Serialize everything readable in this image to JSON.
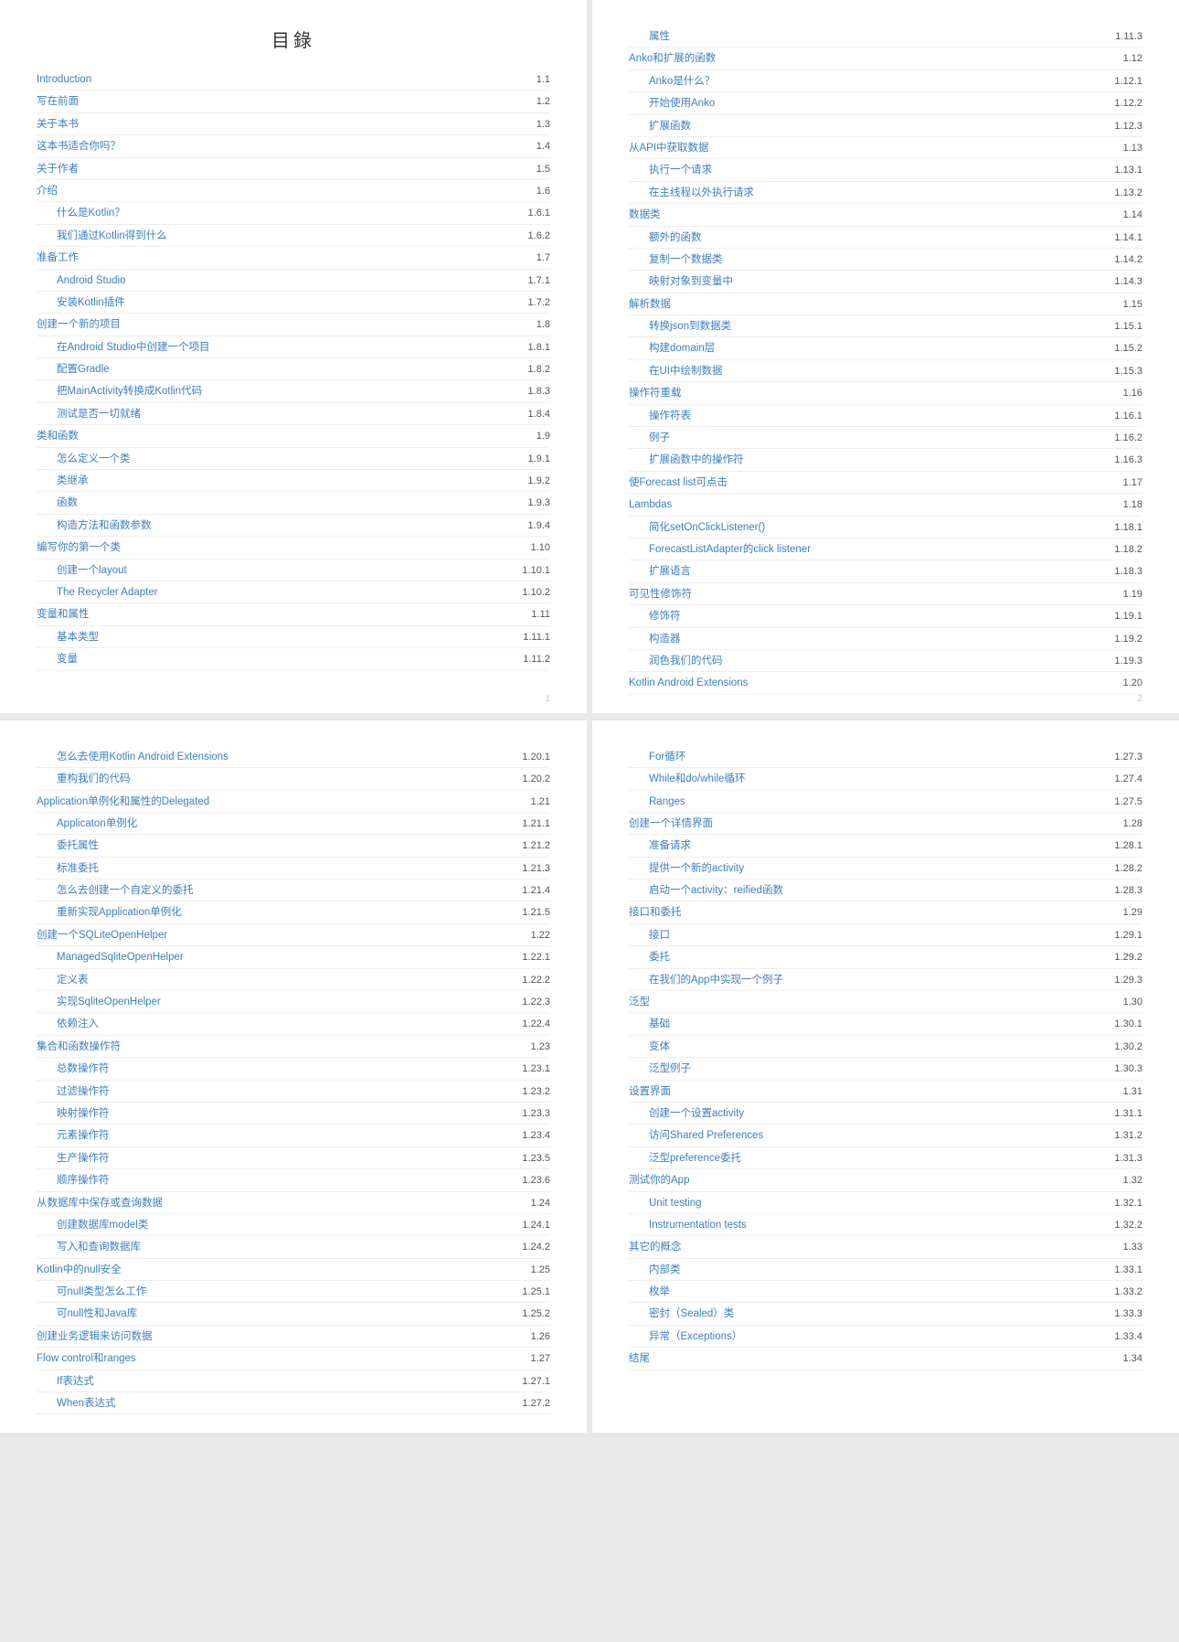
{
  "title": "目錄",
  "pages": [
    {
      "pageNumber": "1",
      "showTitle": true,
      "entries": [
        {
          "label": "Introduction",
          "num": "1.1",
          "level": 0
        },
        {
          "label": "写在前面",
          "num": "1.2",
          "level": 0
        },
        {
          "label": "关于本书",
          "num": "1.3",
          "level": 0
        },
        {
          "label": "这本书适合你吗？",
          "num": "1.4",
          "level": 0
        },
        {
          "label": "关于作者",
          "num": "1.5",
          "level": 0
        },
        {
          "label": "介绍",
          "num": "1.6",
          "level": 0
        },
        {
          "label": "什么是Kotlin？",
          "num": "1.6.1",
          "level": 1
        },
        {
          "label": "我们通过Kotlin得到什么",
          "num": "1.6.2",
          "level": 1
        },
        {
          "label": "准备工作",
          "num": "1.7",
          "level": 0
        },
        {
          "label": "Android Studio",
          "num": "1.7.1",
          "level": 1
        },
        {
          "label": "安装Kotlin插件",
          "num": "1.7.2",
          "level": 1
        },
        {
          "label": "创建一个新的项目",
          "num": "1.8",
          "level": 0
        },
        {
          "label": "在Android Studio中创建一个项目",
          "num": "1.8.1",
          "level": 1
        },
        {
          "label": "配置Gradle",
          "num": "1.8.2",
          "level": 1
        },
        {
          "label": "把MainActivity转换成Kotlin代码",
          "num": "1.8.3",
          "level": 1
        },
        {
          "label": "测试是否一切就绪",
          "num": "1.8.4",
          "level": 1
        },
        {
          "label": "类和函数",
          "num": "1.9",
          "level": 0
        },
        {
          "label": "怎么定义一个类",
          "num": "1.9.1",
          "level": 1
        },
        {
          "label": "类继承",
          "num": "1.9.2",
          "level": 1
        },
        {
          "label": "函数",
          "num": "1.9.3",
          "level": 1
        },
        {
          "label": "构造方法和函数参数",
          "num": "1.9.4",
          "level": 1
        },
        {
          "label": "编写你的第一个类",
          "num": "1.10",
          "level": 0
        },
        {
          "label": "创建一个layout",
          "num": "1.10.1",
          "level": 1
        },
        {
          "label": "The Recycler Adapter",
          "num": "1.10.2",
          "level": 1
        },
        {
          "label": "变量和属性",
          "num": "1.11",
          "level": 0
        },
        {
          "label": "基本类型",
          "num": "1.11.1",
          "level": 1
        },
        {
          "label": "变量",
          "num": "1.11.2",
          "level": 1
        }
      ]
    },
    {
      "pageNumber": "2",
      "showTitle": false,
      "entries": [
        {
          "label": "属性",
          "num": "1.11.3",
          "level": 1
        },
        {
          "label": "Anko和扩展的函数",
          "num": "1.12",
          "level": 0
        },
        {
          "label": "Anko是什么？",
          "num": "1.12.1",
          "level": 1
        },
        {
          "label": "开始使用Anko",
          "num": "1.12.2",
          "level": 1
        },
        {
          "label": "扩展函数",
          "num": "1.12.3",
          "level": 1
        },
        {
          "label": "从API中获取数据",
          "num": "1.13",
          "level": 0
        },
        {
          "label": "执行一个请求",
          "num": "1.13.1",
          "level": 1
        },
        {
          "label": "在主线程以外执行请求",
          "num": "1.13.2",
          "level": 1
        },
        {
          "label": "数据类",
          "num": "1.14",
          "level": 0
        },
        {
          "label": "额外的函数",
          "num": "1.14.1",
          "level": 1
        },
        {
          "label": "复制一个数据类",
          "num": "1.14.2",
          "level": 1
        },
        {
          "label": "映射对象到变量中",
          "num": "1.14.3",
          "level": 1
        },
        {
          "label": "解析数据",
          "num": "1.15",
          "level": 0
        },
        {
          "label": "转换json到数据类",
          "num": "1.15.1",
          "level": 1
        },
        {
          "label": "构建domain层",
          "num": "1.15.2",
          "level": 1
        },
        {
          "label": "在UI中绘制数据",
          "num": "1.15.3",
          "level": 1
        },
        {
          "label": "操作符重载",
          "num": "1.16",
          "level": 0
        },
        {
          "label": "操作符表",
          "num": "1.16.1",
          "level": 1
        },
        {
          "label": "例子",
          "num": "1.16.2",
          "level": 1
        },
        {
          "label": "扩展函数中的操作符",
          "num": "1.16.3",
          "level": 1
        },
        {
          "label": "使Forecast list可点击",
          "num": "1.17",
          "level": 0
        },
        {
          "label": "Lambdas",
          "num": "1.18",
          "level": 0
        },
        {
          "label": "简化setOnClickListener()",
          "num": "1.18.1",
          "level": 1
        },
        {
          "label": "ForecastListAdapter的click listener",
          "num": "1.18.2",
          "level": 1
        },
        {
          "label": "扩展语言",
          "num": "1.18.3",
          "level": 1
        },
        {
          "label": "可见性修饰符",
          "num": "1.19",
          "level": 0
        },
        {
          "label": "修饰符",
          "num": "1.19.1",
          "level": 1
        },
        {
          "label": "构造器",
          "num": "1.19.2",
          "level": 1
        },
        {
          "label": "润色我们的代码",
          "num": "1.19.3",
          "level": 1
        },
        {
          "label": "Kotlin Android Extensions",
          "num": "1.20",
          "level": 0
        }
      ]
    },
    {
      "pageNumber": "",
      "showTitle": false,
      "entries": [
        {
          "label": "怎么去使用Kotlin Android Extensions",
          "num": "1.20.1",
          "level": 1
        },
        {
          "label": "重构我们的代码",
          "num": "1.20.2",
          "level": 1
        },
        {
          "label": "Application单例化和属性的Delegated",
          "num": "1.21",
          "level": 0
        },
        {
          "label": "Applicaton单例化",
          "num": "1.21.1",
          "level": 1
        },
        {
          "label": "委托属性",
          "num": "1.21.2",
          "level": 1
        },
        {
          "label": "标准委托",
          "num": "1.21.3",
          "level": 1
        },
        {
          "label": "怎么去创建一个自定义的委托",
          "num": "1.21.4",
          "level": 1
        },
        {
          "label": "重新实现Application单例化",
          "num": "1.21.5",
          "level": 1
        },
        {
          "label": "创建一个SQLiteOpenHelper",
          "num": "1.22",
          "level": 0
        },
        {
          "label": "ManagedSqliteOpenHelper",
          "num": "1.22.1",
          "level": 1
        },
        {
          "label": "定义表",
          "num": "1.22.2",
          "level": 1
        },
        {
          "label": "实现SqliteOpenHelper",
          "num": "1.22.3",
          "level": 1
        },
        {
          "label": "依赖注入",
          "num": "1.22.4",
          "level": 1
        },
        {
          "label": "集合和函数操作符",
          "num": "1.23",
          "level": 0
        },
        {
          "label": "总数操作符",
          "num": "1.23.1",
          "level": 1
        },
        {
          "label": "过滤操作符",
          "num": "1.23.2",
          "level": 1
        },
        {
          "label": "映射操作符",
          "num": "1.23.3",
          "level": 1
        },
        {
          "label": "元素操作符",
          "num": "1.23.4",
          "level": 1
        },
        {
          "label": "生产操作符",
          "num": "1.23.5",
          "level": 1
        },
        {
          "label": "顺序操作符",
          "num": "1.23.6",
          "level": 1
        },
        {
          "label": "从数据库中保存或查询数据",
          "num": "1.24",
          "level": 0
        },
        {
          "label": "创建数据库model类",
          "num": "1.24.1",
          "level": 1
        },
        {
          "label": "写入和查询数据库",
          "num": "1.24.2",
          "level": 1
        },
        {
          "label": "Kotlin中的null安全",
          "num": "1.25",
          "level": 0
        },
        {
          "label": "可null类型怎么工作",
          "num": "1.25.1",
          "level": 1
        },
        {
          "label": "可null性和Java库",
          "num": "1.25.2",
          "level": 1
        },
        {
          "label": "创建业务逻辑来访问数据",
          "num": "1.26",
          "level": 0
        },
        {
          "label": "Flow control和ranges",
          "num": "1.27",
          "level": 0
        },
        {
          "label": "If表达式",
          "num": "1.27.1",
          "level": 1
        },
        {
          "label": "When表达式",
          "num": "1.27.2",
          "level": 1
        }
      ]
    },
    {
      "pageNumber": "",
      "showTitle": false,
      "entries": [
        {
          "label": "For循环",
          "num": "1.27.3",
          "level": 1
        },
        {
          "label": "While和do/while循环",
          "num": "1.27.4",
          "level": 1
        },
        {
          "label": "Ranges",
          "num": "1.27.5",
          "level": 1
        },
        {
          "label": "创建一个详情界面",
          "num": "1.28",
          "level": 0
        },
        {
          "label": "准备请求",
          "num": "1.28.1",
          "level": 1
        },
        {
          "label": "提供一个新的activity",
          "num": "1.28.2",
          "level": 1
        },
        {
          "label": "启动一个activity：reified函数",
          "num": "1.28.3",
          "level": 1
        },
        {
          "label": "接口和委托",
          "num": "1.29",
          "level": 0
        },
        {
          "label": "接口",
          "num": "1.29.1",
          "level": 1
        },
        {
          "label": "委托",
          "num": "1.29.2",
          "level": 1
        },
        {
          "label": "在我们的App中实现一个例子",
          "num": "1.29.3",
          "level": 1
        },
        {
          "label": "泛型",
          "num": "1.30",
          "level": 0
        },
        {
          "label": "基础",
          "num": "1.30.1",
          "level": 1
        },
        {
          "label": "变体",
          "num": "1.30.2",
          "level": 1
        },
        {
          "label": "泛型例子",
          "num": "1.30.3",
          "level": 1
        },
        {
          "label": "设置界面",
          "num": "1.31",
          "level": 0
        },
        {
          "label": "创建一个设置activity",
          "num": "1.31.1",
          "level": 1
        },
        {
          "label": "访问Shared Preferences",
          "num": "1.31.2",
          "level": 1
        },
        {
          "label": "泛型preference委托",
          "num": "1.31.3",
          "level": 1
        },
        {
          "label": "测试你的App",
          "num": "1.32",
          "level": 0
        },
        {
          "label": "Unit testing",
          "num": "1.32.1",
          "level": 1
        },
        {
          "label": "Instrumentation tests",
          "num": "1.32.2",
          "level": 1
        },
        {
          "label": "其它的概念",
          "num": "1.33",
          "level": 0
        },
        {
          "label": "内部类",
          "num": "1.33.1",
          "level": 1
        },
        {
          "label": "枚举",
          "num": "1.33.2",
          "level": 1
        },
        {
          "label": "密封（Sealed）类",
          "num": "1.33.3",
          "level": 1
        },
        {
          "label": "异常（Exceptions）",
          "num": "1.33.4",
          "level": 1
        },
        {
          "label": "结尾",
          "num": "1.34",
          "level": 0
        }
      ]
    }
  ]
}
